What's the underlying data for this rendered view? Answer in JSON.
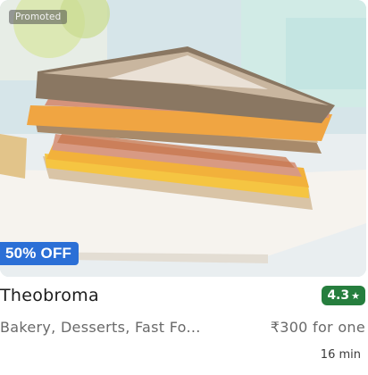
{
  "badge": {
    "promoted": "Promoted",
    "offer": "50% OFF"
  },
  "restaurant": {
    "name": "Theobroma",
    "rating": "4.3",
    "cuisine": "Bakery, Desserts, Fast Fo...",
    "price": "₹300 for one",
    "delivery_time": "16 min"
  },
  "icons": {
    "rating": "star-icon",
    "image": "sandwich-photo"
  },
  "colors": {
    "offer_badge": "#2b6fd6",
    "rating_badge": "#267e3e"
  }
}
